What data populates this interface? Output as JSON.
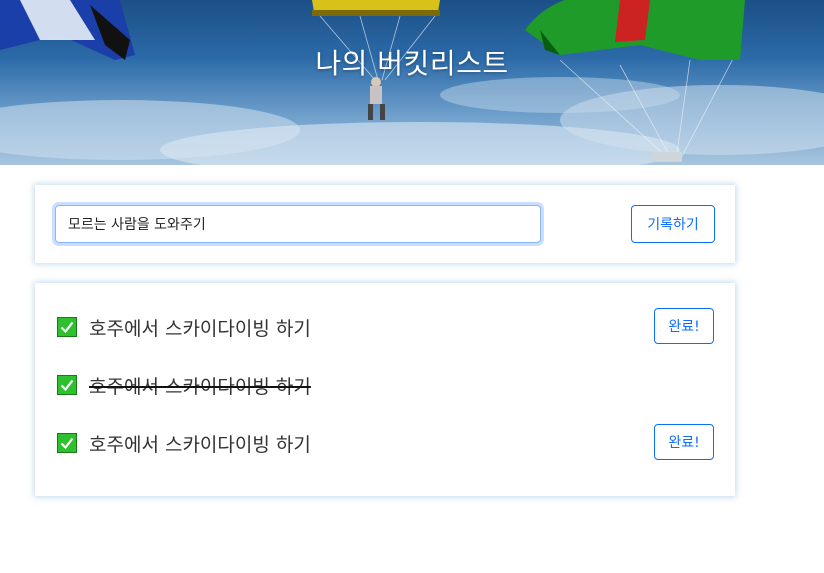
{
  "header": {
    "title": "나의 버킷리스트"
  },
  "form": {
    "input_value": "모르는 사람을 도와주기",
    "submit_label": "기록하기"
  },
  "bucket_list": [
    {
      "text": "호주에서 스카이다이빙 하기",
      "done": false,
      "button_label": "완료!"
    },
    {
      "text": "호주에서 스카이다이빙 하기",
      "done": true
    },
    {
      "text": "호주에서 스카이다이빙 하기",
      "done": false,
      "button_label": "완료!"
    }
  ],
  "colors": {
    "accent": "#0d6efd",
    "check_fill": "#2ec02e",
    "title_text": "#ffffff"
  },
  "icons": {
    "checkbox": "checked-checkbox-icon"
  }
}
